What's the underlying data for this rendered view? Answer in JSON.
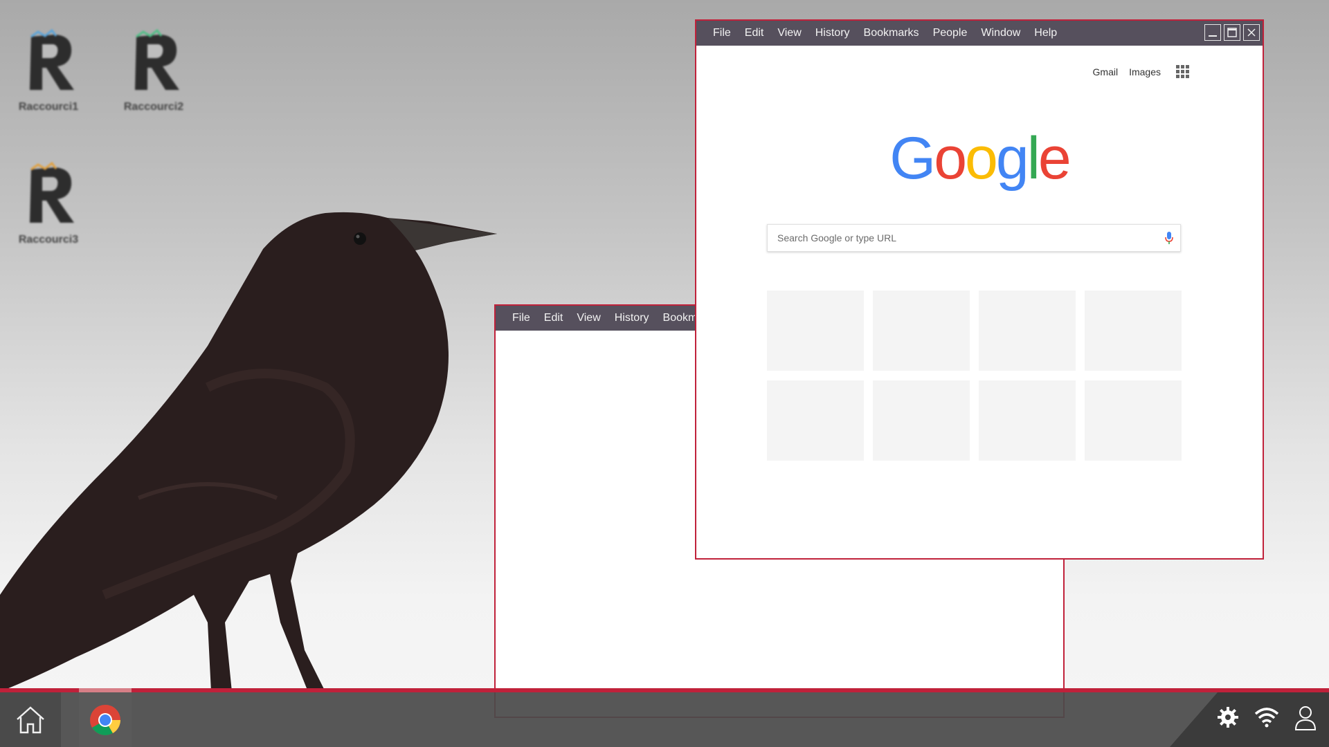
{
  "desktop": {
    "shortcuts": [
      {
        "label": "Raccourci1",
        "color": "#5aa3d8"
      },
      {
        "label": "Raccourci2",
        "color": "#4fbf86"
      },
      {
        "label": "Raccourci3",
        "color": "#e0a040"
      }
    ]
  },
  "back_window": {
    "menu": [
      "File",
      "Edit",
      "View",
      "History",
      "Bookmarks"
    ]
  },
  "browser_window": {
    "menu": [
      "File",
      "Edit",
      "View",
      "History",
      "Bookmarks",
      "People",
      "Window",
      "Help"
    ],
    "controls": [
      "minimize-icon",
      "maximize-icon",
      "close-icon"
    ],
    "top_links": {
      "gmail": "Gmail",
      "images": "Images"
    },
    "logo": {
      "letters": [
        "G",
        "o",
        "o",
        "g",
        "l",
        "e"
      ],
      "colors": [
        "#4285F4",
        "#EA4335",
        "#FBBC05",
        "#4285F4",
        "#34A853",
        "#EA4335"
      ]
    },
    "search": {
      "placeholder": "Search Google or type URL",
      "value": ""
    },
    "tile_count": 8
  },
  "taskbar": {
    "accent": "#c0213a",
    "left_icons": [
      "home-icon",
      "chrome-icon"
    ],
    "right_icons": [
      "settings-icon",
      "wifi-icon",
      "user-icon"
    ]
  }
}
